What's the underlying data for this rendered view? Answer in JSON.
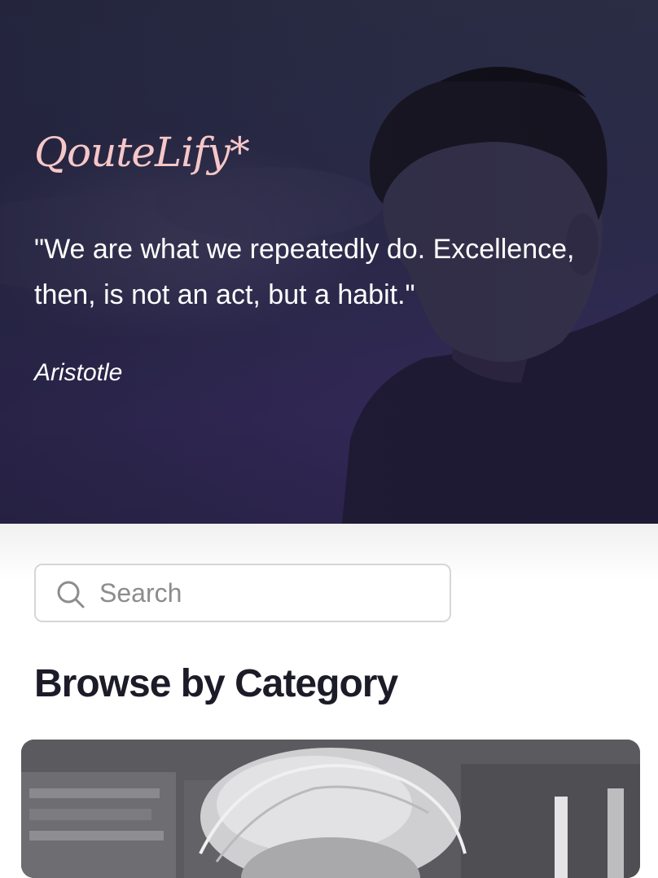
{
  "hero": {
    "logo": "QouteLify*",
    "quote": "\"We are what we repeatedly do. Excellence, then, is not an act, but a habit.\"",
    "author": "Aristotle",
    "background_color": "#2b2a4a",
    "logo_color": "#f6c7c8"
  },
  "search": {
    "placeholder": "Search",
    "value": "",
    "icon": "search-icon"
  },
  "browse": {
    "title": "Browse by Category"
  }
}
